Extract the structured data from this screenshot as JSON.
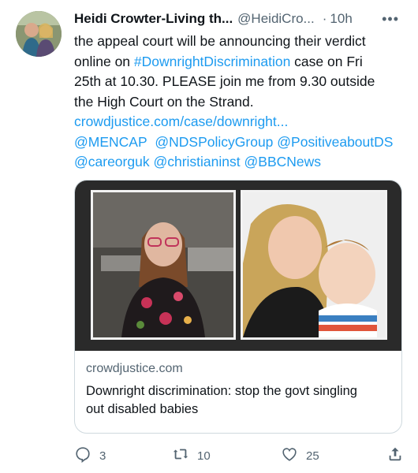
{
  "author": {
    "name": "Heidi Crowter-Living th...",
    "handle": "@HeidiCro...",
    "time": "10h"
  },
  "more_label": "•••",
  "tweet": {
    "line1": "the appeal court will be announcing their verdict",
    "line2_pre": "online on ",
    "line2_hashtag": "#DownrightDiscrimination",
    "line2_post": " case on Fri",
    "line3": "25th at 10.30.  PLEASE join me from 9.30 outside",
    "line4": "the High Court on the Strand.",
    "link": "crowdjustice.com/case/downright...",
    "mentions_line1": [
      "@MENCAP",
      "@NDSPolicyGroup",
      "@PositiveaboutDS"
    ],
    "mentions_line2": [
      "@careorguk",
      "@christianinst",
      "@BBCNews"
    ]
  },
  "card": {
    "domain": "crowdjustice.com",
    "title_line1": "Downright discrimination: stop the govt singling",
    "title_line2": "out disabled babies"
  },
  "actions": {
    "replies": "3",
    "retweets": "10",
    "likes": "25"
  },
  "colors": {
    "link": "#1d9bf0",
    "secondary_text": "#536471",
    "border": "#cfd9de"
  }
}
